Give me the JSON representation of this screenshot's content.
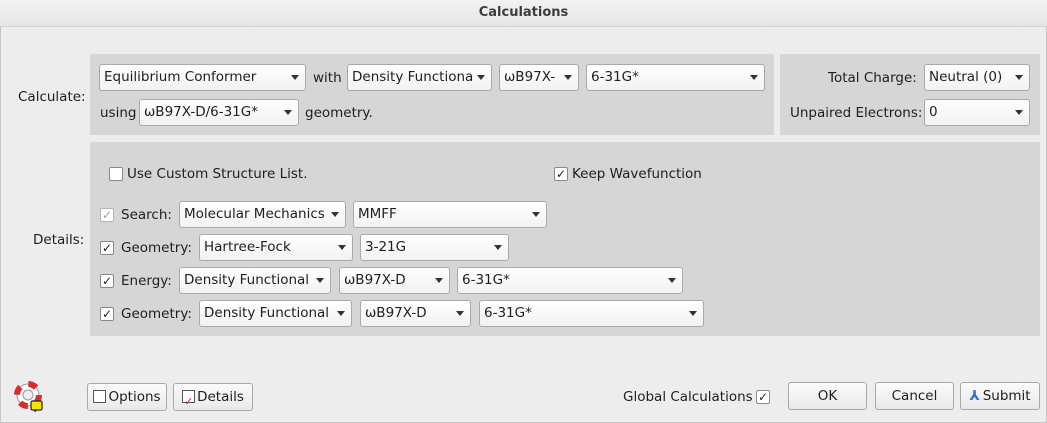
{
  "window": {
    "title": "Calculations"
  },
  "calculate": {
    "label": "Calculate:",
    "type": "Equilibrium Conformer",
    "with_label": "with",
    "method": "Density Functiona",
    "functional": "ωB97X-",
    "basis": "6-31G*",
    "using_label": "using",
    "geometry_source": "ωB97X-D/6-31G*",
    "geometry_label": "geometry."
  },
  "charge": {
    "total_charge_label": "Total Charge:",
    "total_charge_value": "Neutral (0)",
    "unpaired_label": "Unpaired Electrons:",
    "unpaired_value": "0"
  },
  "details": {
    "label": "Details:",
    "custom_structure_label": "Use Custom Structure List.",
    "custom_structure_checked": false,
    "keep_wavefunction_label": "Keep Wavefunction",
    "keep_wavefunction_checked": true,
    "rows": [
      {
        "label": "Search:",
        "checked": true,
        "disabled": true,
        "method": "Molecular Mechanics",
        "basis": "MMFF"
      },
      {
        "label": "Geometry:",
        "checked": true,
        "method": "Hartree-Fock",
        "basis": "3-21G"
      },
      {
        "label": "Energy:",
        "checked": true,
        "method": "Density Functional",
        "functional": "ωB97X-D",
        "basis": "6-31G*"
      },
      {
        "label": "Geometry:",
        "checked": true,
        "method": "Density Functional",
        "functional": "ωB97X-D",
        "basis": "6-31G*"
      }
    ]
  },
  "footer": {
    "options_label": "Options",
    "details_label": "Details",
    "global_calc_label": "Global Calculations",
    "global_calc_checked": true,
    "ok_label": "OK",
    "cancel_label": "Cancel",
    "submit_label": "Submit"
  },
  "icons": {
    "help": "lifebuoy-icon",
    "submit": "submit-icon"
  },
  "colors": {
    "panel": "#d6d6d6",
    "background": "#ededed"
  }
}
